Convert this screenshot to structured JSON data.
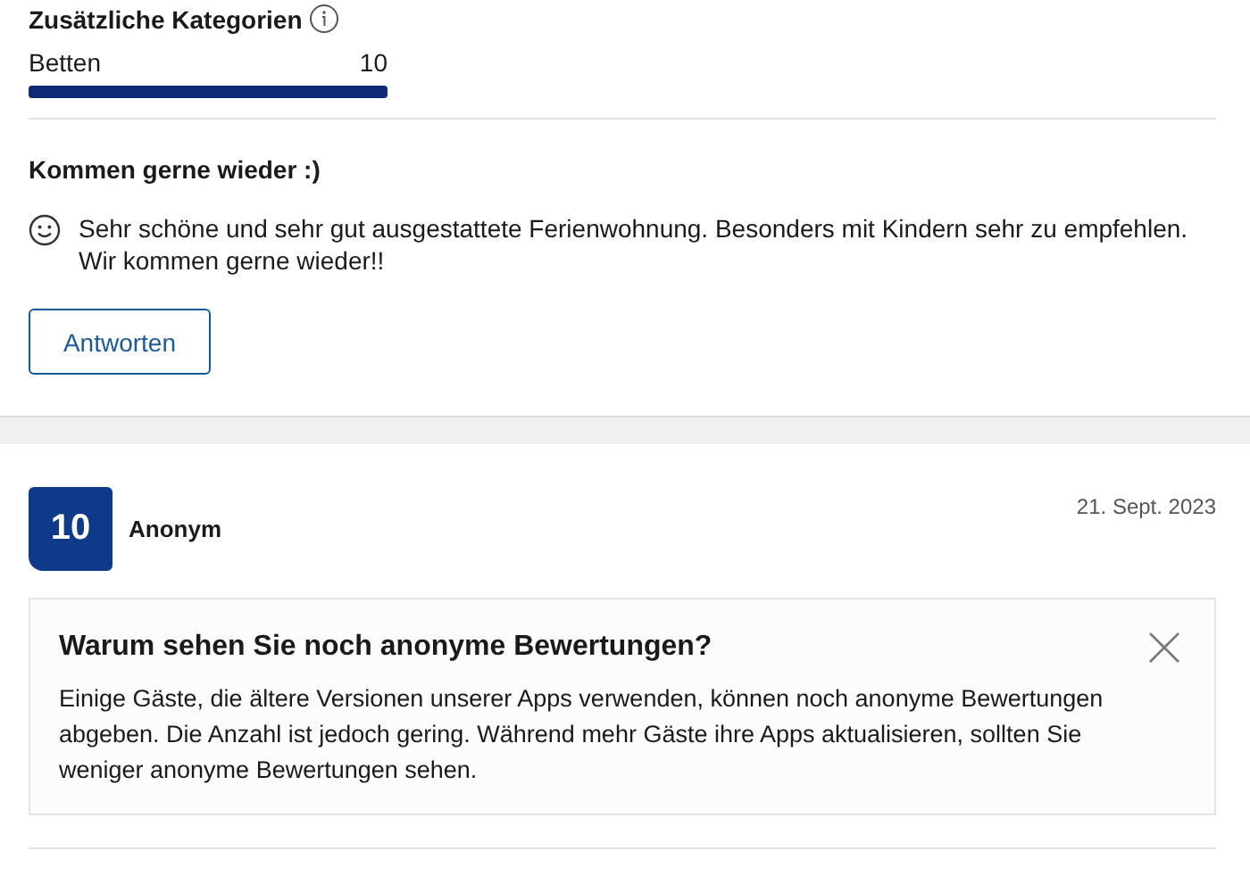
{
  "review_1": {
    "categories_heading": "Zusätzliche Kategorien",
    "categories": [
      {
        "name": "Betten",
        "score": "10",
        "level": 1
      }
    ],
    "title": "Kommen gerne wieder :)",
    "text": "Sehr schöne und sehr gut ausgestattete Ferienwohnung. Besonders mit Kindern sehr zu empfehlen. Wir kommen gerne wieder!!",
    "reply_button": "Antworten"
  },
  "review_2": {
    "score": "10",
    "author": "Anonym",
    "date": "21. Sept. 2023",
    "notice": {
      "title": "Warum sehen Sie noch anonyme Bewertungen?",
      "text": "Einige Gäste, die ältere Versionen unserer Apps verwenden, können noch anonyme Bewertungen abgeben. Die Anzahl ist jedoch gering. Während mehr Gäste ihre Apps aktualisieren, sollten Sie weniger anonyme Bewertungen sehen."
    }
  }
}
